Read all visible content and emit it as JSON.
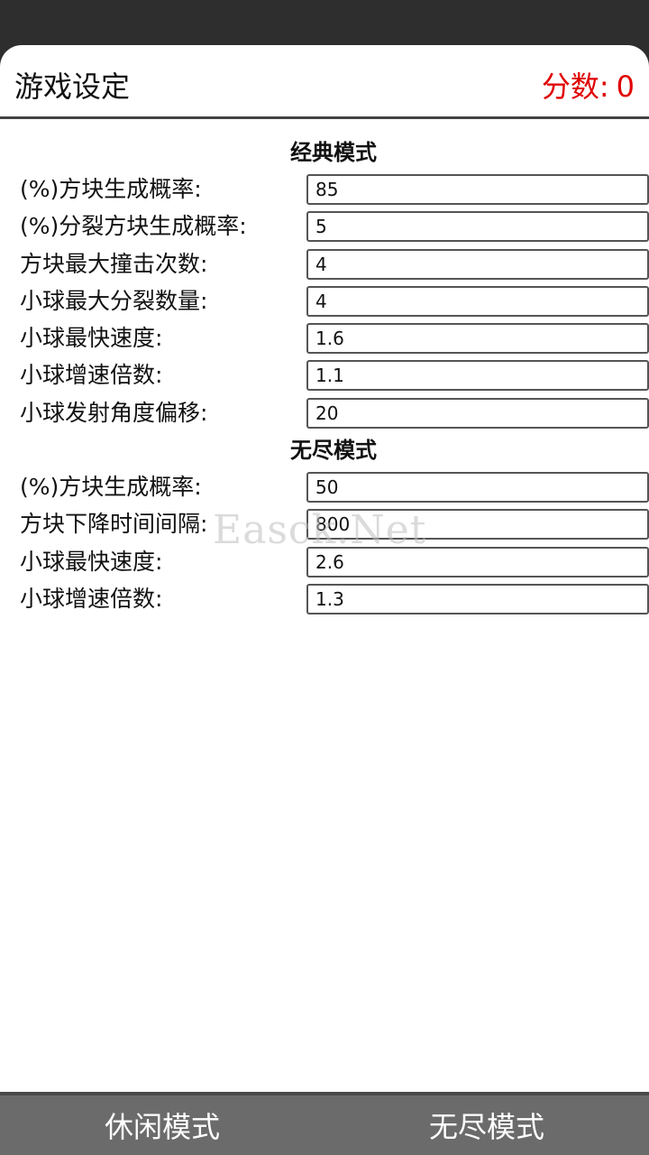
{
  "header": {
    "title": "游戏设定",
    "score_label": "分数:",
    "score_value": "0"
  },
  "classic": {
    "heading": "经典模式",
    "rows": [
      {
        "label": "(%)方块生成概率:",
        "value": "85"
      },
      {
        "label": "(%)分裂方块生成概率:",
        "value": "5"
      },
      {
        "label": "方块最大撞击次数:",
        "value": "4"
      },
      {
        "label": "小球最大分裂数量:",
        "value": "4"
      },
      {
        "label": "小球最快速度:",
        "value": "1.6"
      },
      {
        "label": "小球增速倍数:",
        "value": "1.1"
      },
      {
        "label": "小球发射角度偏移:",
        "value": "20"
      }
    ]
  },
  "endless": {
    "heading": "无尽模式",
    "rows": [
      {
        "label": "(%)方块生成概率:",
        "value": "50"
      },
      {
        "label": "方块下降时间间隔:",
        "value": "800"
      },
      {
        "label": "小球最快速度:",
        "value": "2.6"
      },
      {
        "label": "小球增速倍数:",
        "value": "1.3"
      }
    ]
  },
  "watermark": "Easck.Net",
  "bottom_bar": {
    "left_label": "休闲模式",
    "right_label": "无尽模式"
  }
}
